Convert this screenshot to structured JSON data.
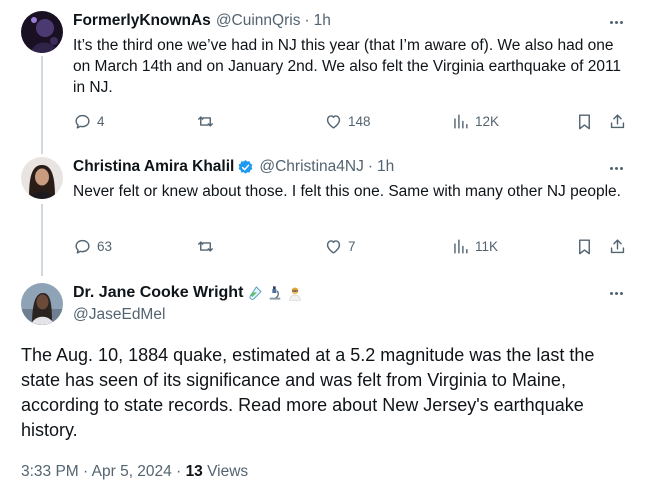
{
  "replies": [
    {
      "name": "FormerlyKnownAs",
      "handle": "@CuinnQris",
      "time": "1h",
      "text": "It’s the third one we’ve had in NJ this year (that I’m aware of). We also had one on March 14th and on January 2nd. We also felt the Virginia earthquake of 2011 in NJ.",
      "replies_count": "4",
      "retweets_count": "",
      "likes_count": "148",
      "views_count": "12K"
    },
    {
      "name": "Christina Amira Khalil",
      "handle": "@Christina4NJ",
      "time": "1h",
      "text": "Never felt or knew about those. I felt this one. Same with many other NJ people.",
      "replies_count": "63",
      "retweets_count": "",
      "likes_count": "7",
      "views_count": "11K"
    }
  ],
  "main_post": {
    "name": "Dr. Jane Cooke Wright",
    "handle": "@JaseEdMel",
    "text": "The Aug. 10, 1884 quake, estimated at a 5.2 magnitude was the last the state has seen of its significance and was felt from Virginia to Maine, according to state records. Read more about New Jersey's earthquake history.",
    "timestamp": "3:33 PM · Apr 5, 2024 · ",
    "views_count": "13",
    "views_label": " Views"
  },
  "separator": "·",
  "colors": {
    "text": "#0f1419",
    "muted": "#536471",
    "verified": "#1d9bf0",
    "thread_line": "#cfd9de"
  },
  "icons": [
    "reply-icon",
    "retweet-icon",
    "like-icon",
    "views-icon",
    "bookmark-icon",
    "share-icon",
    "more-icon",
    "verified-badge-icon"
  ]
}
